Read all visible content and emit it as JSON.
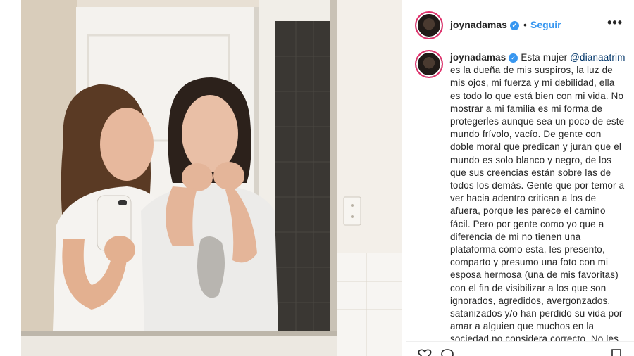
{
  "post": {
    "image_alt": "Two women taking a mirror selfie in a bathroom"
  },
  "header": {
    "username": "joynadamas",
    "verified_glyph": "✓",
    "separator": "•",
    "follow_label": "Seguir",
    "more_label": "•••"
  },
  "caption": {
    "username": "joynadamas",
    "verified_glyph": "✓",
    "intro": " Esta mujer ",
    "mention": "@dianaatrim",
    "body": " es la dueña de mis suspiros, la luz de mis ojos, mi fuerza y mi debilidad, ella es todo lo que está bien con mi vida. No mostrar a mi familia es mi forma de protegerles aunque sea un poco de este mundo frívolo, vacío. De gente con doble moral que predican y juran que el mundo es solo blanco y negro, de los que sus creencias están sobre las de todos los demás. Gente que por temor a ver hacia adentro critican a los de afuera, porque les parece el camino fácil. Pero por gente como yo que a diferencia de mi no tienen una plataforma cómo esta, les presento, comparto y presumo una foto con mi esposa hermosa (una de mis favoritas) con el fin de visibilizar a los que son ignorados, agredidos, avergonzados, satanizados y/o han perdido su vida por amar a alguien que muchos en la sociedad no considera correcto. No les deseo un feliz día de los"
  },
  "actions": {
    "icons": [
      "heart-icon",
      "comment-icon",
      "bookmark-icon"
    ]
  },
  "colors": {
    "accent": "#3897f0",
    "text": "#262626",
    "mention": "#003569"
  }
}
